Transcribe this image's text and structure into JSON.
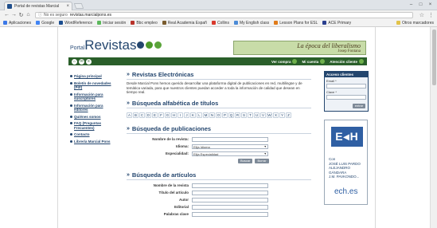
{
  "browser": {
    "tab_title": "Portal de revistas Marcial",
    "tab_close": "×",
    "security": "No es seguro",
    "url": "revistas.marcialpons.es",
    "window_controls": [
      "–",
      "□",
      "×"
    ],
    "bookmarks": [
      {
        "label": "Aplicaciones",
        "color": "#3b78e7"
      },
      {
        "label": "Google",
        "color": "#4285f4"
      },
      {
        "label": "WordReference",
        "color": "#1a4d8f"
      },
      {
        "label": "Iniciar sesión",
        "color": "#5cb85c"
      },
      {
        "label": "Bbc empleo",
        "color": "#b8322a"
      },
      {
        "label": "Real Academia Españ",
        "color": "#7a5c2e"
      },
      {
        "label": "Collins",
        "color": "#d9392c"
      },
      {
        "label": "My English class",
        "color": "#4c8bd6"
      },
      {
        "label": "Lesson Plans for ESL",
        "color": "#e07b1a"
      },
      {
        "label": "ACE Primary",
        "color": "#2a3f8f"
      }
    ],
    "other_bookmarks": "Otros marcadores"
  },
  "header": {
    "logo_portal": "Portal",
    "logo_revistas": "Revistas",
    "logo_dot_colors": [
      "#24466e",
      "#4c9a2a",
      "#5aa43a"
    ],
    "banner_title": "La época del liberalismo",
    "banner_author": "Josep Fontana",
    "nav_links": [
      "Ver compra",
      "Mi cuenta",
      "Atención cliente"
    ]
  },
  "sidebar": {
    "items": [
      "Página principal",
      "Boletín de novedades (Pdf)",
      "Información para suscriptores",
      "Información para editores",
      "Quiénes somos",
      "FAQ (Preguntas Frecuentes)",
      "Contacto",
      "Librería Marcial Pons"
    ]
  },
  "main": {
    "sec1_title": "Revistas Electrónicas",
    "sec1_desc": "Desde Marcial Pons hemos querido desarrollar una plataforma digital de publicaciones en red, multilingüe y de temática variada, para que nuestros clientes puedan acceder a toda la información de calidad que desean en tiempo real.",
    "sec2_title": "Búsqueda alfabética de títulos",
    "letters": [
      "A",
      "B",
      "C",
      "D",
      "E",
      "F",
      "G",
      "H",
      "I",
      "J",
      "K",
      "L",
      "M",
      "N",
      "O",
      "P",
      "Q",
      "R",
      "S",
      "T",
      "U",
      "V",
      "W",
      "X",
      "Y",
      "Z"
    ],
    "sec3_title": "Búsqueda de publicaciones",
    "pub_labels": [
      "Nombre de la revista:",
      "Idioma:",
      "Especialidad:"
    ],
    "pub_idioma_value": "Elija Idioma",
    "pub_especialidad_value": "Elija Especialidad",
    "pub_buttons": [
      "Buscar",
      "Borrar"
    ],
    "sec4_title": "Búsqueda de artículos",
    "art_labels": [
      "Nombre de la revista",
      "Título del artículo",
      "Autor",
      "Editorial",
      "Palabras clave"
    ]
  },
  "right": {
    "access_title": "Acceso clientes",
    "email_label": "Email *",
    "password_label": "Clave *",
    "enter_button": "entrar",
    "ad_logo": "E◂H",
    "ad_text": [
      "Con",
      "JOSÉ LUIS PARDO",
      "ALEJANDRO GÁNDARA",
      "J.M. PAVKONDO..."
    ],
    "ad_footer": "ech.es"
  }
}
